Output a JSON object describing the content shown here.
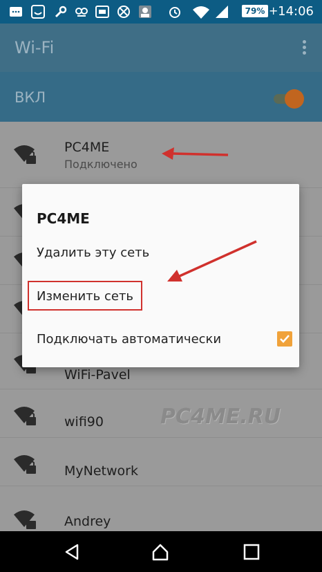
{
  "status_bar": {
    "battery": "79%",
    "time": "14:06"
  },
  "app_bar": {
    "title": "Wi-Fi"
  },
  "wifi_switch": {
    "label": "ВКЛ",
    "on": true
  },
  "networks": [
    {
      "name": "PC4ME",
      "status": "Подключено"
    },
    {
      "name": "WiFi-Pavel"
    },
    {
      "name": "wifi90"
    },
    {
      "name": "MyNetwork"
    },
    {
      "name": "Andrey"
    }
  ],
  "dialog": {
    "title": "PC4ME",
    "delete_label": "Удалить эту сеть",
    "edit_label": "Изменить сеть",
    "auto_connect_label": "Подключать автоматически",
    "auto_connect_checked": true
  },
  "watermark": "PC4ME.RU",
  "colors": {
    "status_bar": "#0d5c84",
    "app_bar": "#3f6e86",
    "accent": "#f0a23a",
    "annotation": "#d0312d"
  }
}
